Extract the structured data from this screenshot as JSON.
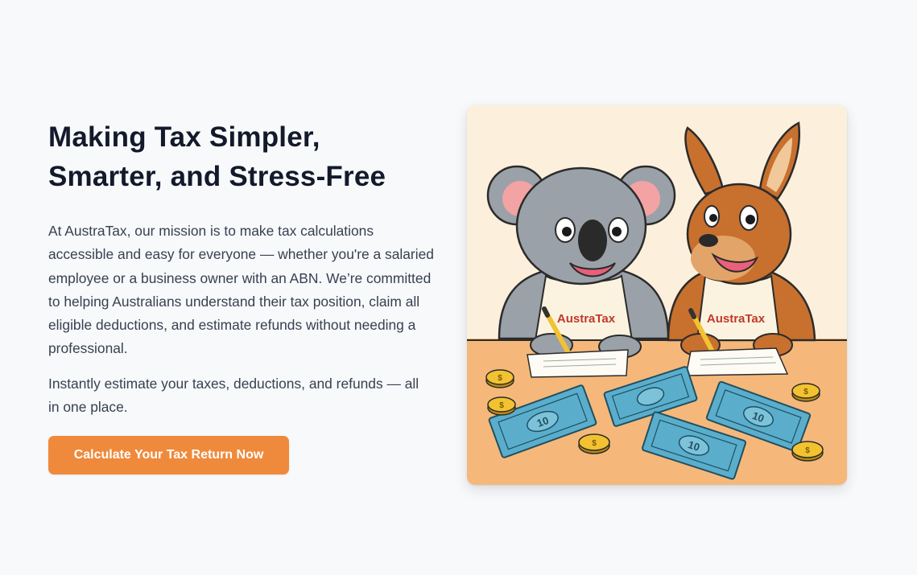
{
  "hero": {
    "heading_line1": "Making Tax Simpler,",
    "heading_line2": "Smarter, and Stress-Free",
    "mission": "At AustraTax, our mission is to make tax calculations accessible and easy for everyone — whether you're a salaried employee or a business owner with an ABN. We’re committed to helping Australians understand their tax position, claim all eligible deductions, and estimate refunds without needing a professional.",
    "tagline": "Instantly estimate your taxes, deductions, and refunds — all in one place.",
    "cta_label": "Calculate Your Tax Return Now"
  },
  "illustration": {
    "koala_shirt_brand": "AustraTax",
    "kangaroo_shirt_brand": "AustraTax",
    "banknote_denomination": "10",
    "coin_symbol": "$"
  },
  "colors": {
    "background": "#f8f9fb",
    "heading": "#121a2b",
    "body_text": "#374151",
    "cta_background": "#ef8a3c",
    "cta_text": "#ffffff",
    "wall": "#fcefdc",
    "table": "#f5b87a",
    "banknote": "#5aaecb",
    "coin": "#f2c230"
  }
}
